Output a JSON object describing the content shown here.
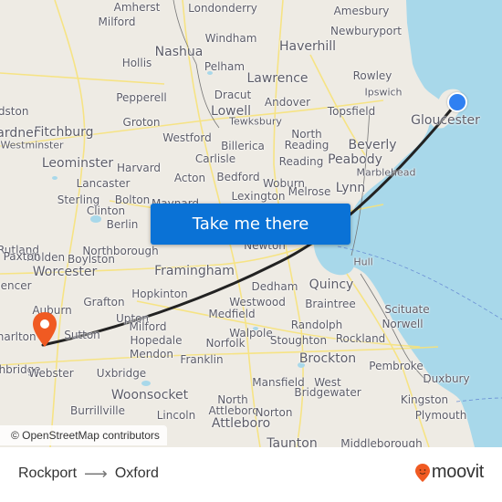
{
  "map": {
    "cta_button": "Take me there",
    "attribution": "© OpenStreetMap contributors",
    "origin_marker": {
      "label": "Rockport",
      "color": "#2f80f2"
    },
    "destination_marker": {
      "label": "Oxford",
      "color": "#f05a22"
    },
    "route_color": "#222222",
    "water_color": "#a8d8ea",
    "land_color": "#eeebe4",
    "places": [
      {
        "name": "Amherst",
        "size": "m"
      },
      {
        "name": "Londonderry",
        "size": "m"
      },
      {
        "name": "Amesbury",
        "size": "m"
      },
      {
        "name": "Milford",
        "size": "m"
      },
      {
        "name": "Newburyport",
        "size": "m"
      },
      {
        "name": "Windham",
        "size": "m"
      },
      {
        "name": "Nashua",
        "size": "l"
      },
      {
        "name": "Haverhill",
        "size": "l"
      },
      {
        "name": "Hollis",
        "size": "m"
      },
      {
        "name": "Pelham",
        "size": "m"
      },
      {
        "name": "Lawrence",
        "size": "l"
      },
      {
        "name": "Rowley",
        "size": "m"
      },
      {
        "name": "Ipswich",
        "size": "s"
      },
      {
        "name": "Dracut",
        "size": "m"
      },
      {
        "name": "Pepperell",
        "size": "m"
      },
      {
        "name": "Andover",
        "size": "m"
      },
      {
        "name": "Lowell",
        "size": "l"
      },
      {
        "name": "Topsfield",
        "size": "m"
      },
      {
        "name": "Gloucester",
        "size": "l"
      },
      {
        "name": "Groton",
        "size": "m"
      },
      {
        "name": "Tewksbury",
        "size": "s"
      },
      {
        "name": "Fitchburg",
        "size": "l"
      },
      {
        "name": "Westford",
        "size": "m"
      },
      {
        "name": "North",
        "size": "m"
      },
      {
        "name": "Reading",
        "size": "m"
      },
      {
        "name": "Billerica",
        "size": "m"
      },
      {
        "name": "Beverly",
        "size": "l"
      },
      {
        "name": "Westminster",
        "size": "s"
      },
      {
        "name": "Gardner",
        "size": "l"
      },
      {
        "name": "Carlisle",
        "size": "m"
      },
      {
        "name": "Peabody",
        "size": "l"
      },
      {
        "name": "Leominster",
        "size": "l"
      },
      {
        "name": "Harvard",
        "size": "m"
      },
      {
        "name": "Reading",
        "size": "m"
      },
      {
        "name": "Marblehead",
        "size": "s"
      },
      {
        "name": "Acton",
        "size": "m"
      },
      {
        "name": "Bedford",
        "size": "m"
      },
      {
        "name": "Lancaster",
        "size": "m"
      },
      {
        "name": "Woburn",
        "size": "m"
      },
      {
        "name": "Melrose",
        "size": "m"
      },
      {
        "name": "Lynn",
        "size": "l"
      },
      {
        "name": "Sterling",
        "size": "m"
      },
      {
        "name": "Bolton",
        "size": "m"
      },
      {
        "name": "Lexington",
        "size": "m"
      },
      {
        "name": "Clinton",
        "size": "m"
      },
      {
        "name": "Maynard",
        "size": "m"
      },
      {
        "name": "Berlin",
        "size": "m"
      },
      {
        "name": "Rutland",
        "size": "m"
      },
      {
        "name": "Holden",
        "size": "m"
      },
      {
        "name": "Boylston",
        "size": "m"
      },
      {
        "name": "Newton",
        "size": "m"
      },
      {
        "name": "Northborough",
        "size": "m"
      },
      {
        "name": "Paxton",
        "size": "m"
      },
      {
        "name": "Hull",
        "size": "s"
      },
      {
        "name": "Worcester",
        "size": "l"
      },
      {
        "name": "Framingham",
        "size": "l"
      },
      {
        "name": "Spencer",
        "size": "m"
      },
      {
        "name": "Hopkinton",
        "size": "m"
      },
      {
        "name": "Dedham",
        "size": "m"
      },
      {
        "name": "Quincy",
        "size": "l"
      },
      {
        "name": "Grafton",
        "size": "m"
      },
      {
        "name": "Westwood",
        "size": "m"
      },
      {
        "name": "Braintree",
        "size": "m"
      },
      {
        "name": "Auburn",
        "size": "m"
      },
      {
        "name": "Scituate",
        "size": "m"
      },
      {
        "name": "Upton",
        "size": "m"
      },
      {
        "name": "Medfield",
        "size": "m"
      },
      {
        "name": "Norwell",
        "size": "m"
      },
      {
        "name": "Milford",
        "size": "m"
      },
      {
        "name": "Randolph",
        "size": "m"
      },
      {
        "name": "Charlton",
        "size": "m"
      },
      {
        "name": "Sutton",
        "size": "m"
      },
      {
        "name": "Hopedale",
        "size": "m"
      },
      {
        "name": "Walpole",
        "size": "m"
      },
      {
        "name": "Norfolk",
        "size": "m"
      },
      {
        "name": "Stoughton",
        "size": "m"
      },
      {
        "name": "Rockland",
        "size": "m"
      },
      {
        "name": "Mendon",
        "size": "m"
      },
      {
        "name": "Franklin",
        "size": "m"
      },
      {
        "name": "Brockton",
        "size": "l"
      },
      {
        "name": "Southbridge",
        "size": "m"
      },
      {
        "name": "Webster",
        "size": "m"
      },
      {
        "name": "Uxbridge",
        "size": "m"
      },
      {
        "name": "Pembroke",
        "size": "m"
      },
      {
        "name": "Mansfield",
        "size": "m"
      },
      {
        "name": "West",
        "size": "m"
      },
      {
        "name": "Duxbury",
        "size": "m"
      },
      {
        "name": "Bridgewater",
        "size": "m"
      },
      {
        "name": "Woonsocket",
        "size": "l"
      },
      {
        "name": "North",
        "size": "m"
      },
      {
        "name": "Kingston",
        "size": "m"
      },
      {
        "name": "Burrillville",
        "size": "m"
      },
      {
        "name": "Attleboro",
        "size": "m"
      },
      {
        "name": "Norton",
        "size": "m"
      },
      {
        "name": "Plymouth",
        "size": "m"
      },
      {
        "name": "Lincoln",
        "size": "m"
      },
      {
        "name": "Attleboro",
        "size": "l"
      },
      {
        "name": "Taunton",
        "size": "l"
      },
      {
        "name": "Middleborough",
        "size": "m"
      },
      {
        "name": "Gardston",
        "size": "m"
      }
    ]
  },
  "footer": {
    "origin": "Rockport",
    "destination": "Oxford",
    "arrow_icon": "arrow-right-icon",
    "brand": "moovit",
    "brand_color": "#f05a22"
  }
}
